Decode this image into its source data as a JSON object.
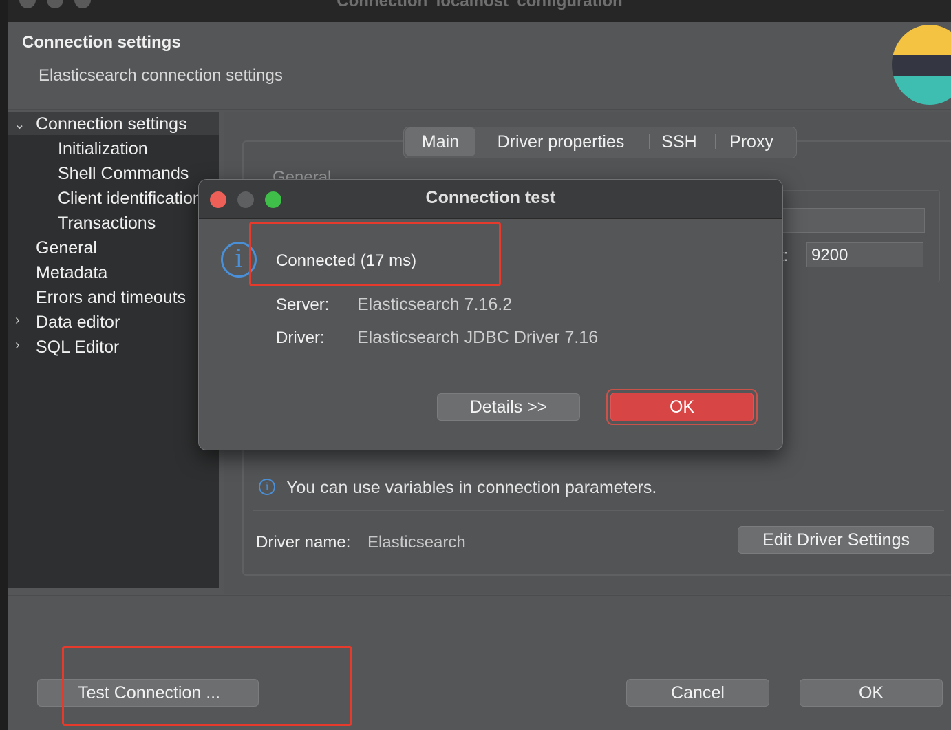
{
  "window": {
    "title": "Connection 'localhost' configuration"
  },
  "header": {
    "title": "Connection settings",
    "subtitle": "Elasticsearch connection settings",
    "logo": "elasticsearch-logo"
  },
  "sidebar": {
    "items": [
      {
        "label": "Connection settings",
        "expandable": true,
        "expanded": true,
        "selected": true
      },
      {
        "label": "Initialization"
      },
      {
        "label": "Shell Commands"
      },
      {
        "label": "Client identification"
      },
      {
        "label": "Transactions"
      },
      {
        "label": "General"
      },
      {
        "label": "Metadata"
      },
      {
        "label": "Errors and timeouts"
      },
      {
        "label": "Data editor",
        "expandable": true
      },
      {
        "label": "SQL Editor",
        "expandable": true
      }
    ]
  },
  "tabs": [
    {
      "label": "Main",
      "active": true
    },
    {
      "label": "Driver properties"
    },
    {
      "label": "SSH"
    },
    {
      "label": "Proxy"
    }
  ],
  "main": {
    "group_label": "General",
    "port_label": "Port:",
    "port_value": "9200",
    "variables_note": "You can use variables in connection parameters.",
    "driver_name_label": "Driver name:",
    "driver_name_value": "Elasticsearch",
    "edit_driver_button": "Edit Driver Settings"
  },
  "footer": {
    "test_connection_button": "Test Connection ...",
    "cancel_button": "Cancel",
    "ok_button": "OK"
  },
  "dialog": {
    "title": "Connection test",
    "status": "Connected (17 ms)",
    "server_label": "Server:",
    "server_value": "Elasticsearch 7.16.2",
    "driver_label": "Driver:",
    "driver_value": "Elasticsearch JDBC Driver 7.16",
    "details_button": "Details >>",
    "ok_button": "OK"
  },
  "colors": {
    "accent_ok": "#d84545",
    "annotation_red": "#e53a2c",
    "info_blue": "#4a90d9"
  }
}
